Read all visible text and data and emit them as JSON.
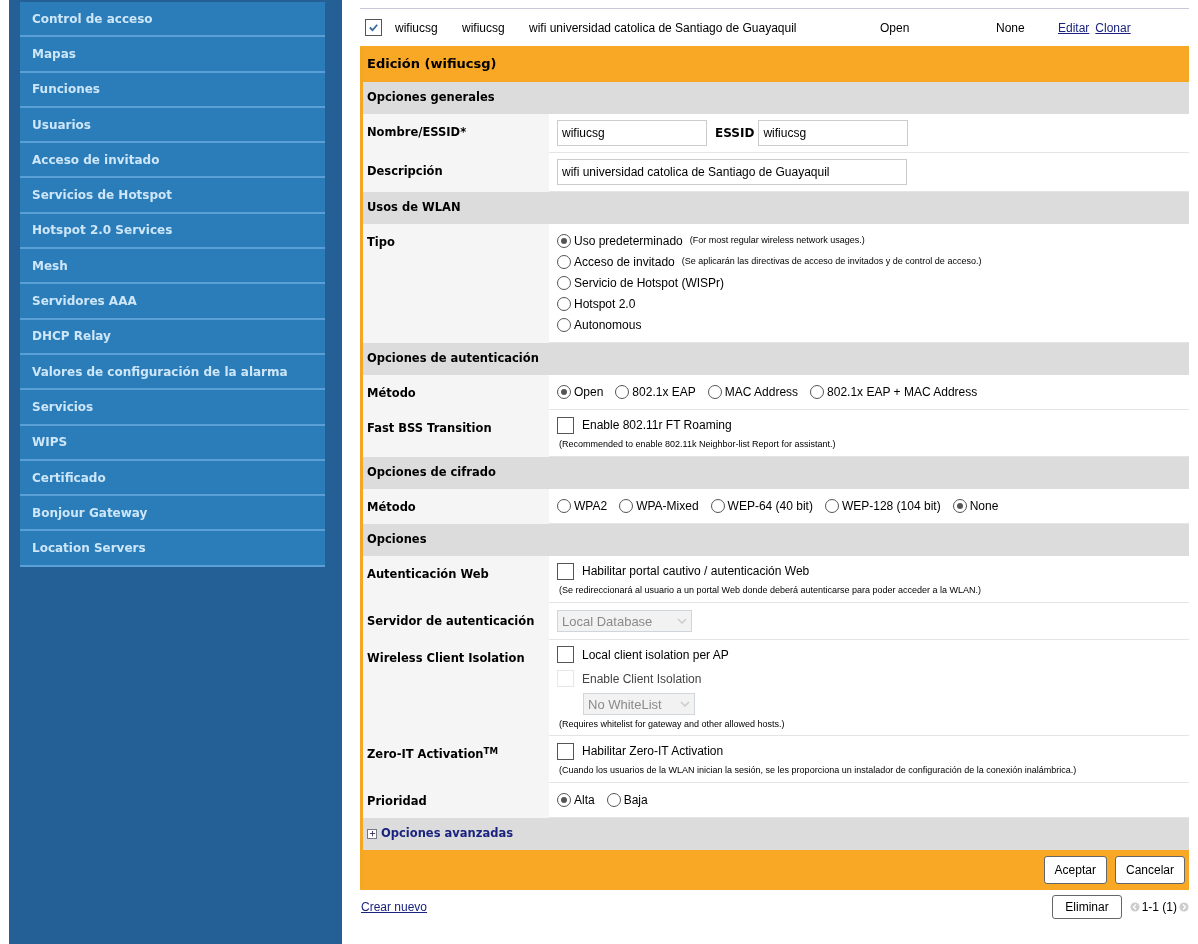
{
  "sidebar": {
    "items": [
      {
        "label": "Control de acceso",
        "selected": false
      },
      {
        "label": "Mapas",
        "selected": false
      },
      {
        "label": "Funciones",
        "selected": false
      },
      {
        "label": "Usuarios",
        "selected": false
      },
      {
        "label": "Acceso de invitado",
        "selected": false
      },
      {
        "label": "Servicios de Hotspot",
        "selected": false
      },
      {
        "label": "Hotspot 2.0 Services",
        "selected": false
      },
      {
        "label": "Mesh",
        "selected": false
      },
      {
        "label": "Servidores AAA",
        "selected": false
      },
      {
        "label": "DHCP Relay",
        "selected": false
      },
      {
        "label": "Valores de configuración de la alarma",
        "selected": false
      },
      {
        "label": "Servicios",
        "selected": false
      },
      {
        "label": "WIPS",
        "selected": false
      },
      {
        "label": "Certificado",
        "selected": false
      },
      {
        "label": "Bonjour Gateway",
        "selected": false
      },
      {
        "label": "Location Servers",
        "selected": false
      }
    ]
  },
  "wlan_row": {
    "checked": true,
    "cells": [
      "wifiucsg",
      "wifiucsg",
      "wifi universidad catolica de Santiago de Guayaquil",
      "Open",
      "None"
    ],
    "links": [
      "Editar",
      "Clonar"
    ]
  },
  "edit_panel": {
    "title": "Edición (wifiucsg)",
    "sections": [
      {
        "title": "Opciones generales",
        "rows": [
          {
            "label": "Nombre/ESSID*",
            "kind": "inline",
            "items": [
              {
                "kind": "text-input",
                "value": "wifiucsg"
              },
              {
                "kind": "inline-label",
                "text": "ESSID"
              },
              {
                "kind": "text-input",
                "value": "wifiucsg"
              }
            ]
          },
          {
            "label": "Descripción",
            "kind": "inline",
            "items": [
              {
                "kind": "text-input",
                "value": "wifi universidad catolica de Santiago de Guayaquil",
                "wide": true
              }
            ]
          }
        ]
      },
      {
        "title": "Usos de WLAN",
        "rows": [
          {
            "label": "Tipo",
            "kind": "stacked",
            "items": [
              {
                "kind": "radio",
                "text": "Uso predeterminado",
                "note": "(For most regular wireless network usages.)",
                "selected": true
              },
              {
                "kind": "radio",
                "text": "Acceso de invitado",
                "note": "(Se aplicarán las directivas de acceso de invitados y de control de acceso.)",
                "selected": false
              },
              {
                "kind": "radio",
                "text": "Servicio de Hotspot (WISPr)",
                "selected": false
              },
              {
                "kind": "radio",
                "text": "Hotspot 2.0",
                "selected": false
              },
              {
                "kind": "radio",
                "text": "Autonomous",
                "selected": false
              }
            ]
          }
        ]
      },
      {
        "title": "Opciones de autenticación",
        "rows": [
          {
            "label": "Método",
            "kind": "inline",
            "items": [
              {
                "kind": "radio",
                "text": "Open",
                "selected": true
              },
              {
                "kind": "radio",
                "text": "802.1x EAP",
                "selected": false
              },
              {
                "kind": "radio",
                "text": "MAC Address",
                "selected": false
              },
              {
                "kind": "radio",
                "text": "802.1x EAP + MAC Address",
                "selected": false
              }
            ]
          },
          {
            "label": "Fast BSS Transition",
            "kind": "stacked",
            "items": [
              {
                "kind": "checkbox",
                "text": "Enable 802.11r FT Roaming",
                "checked": false,
                "disabled": false
              },
              {
                "kind": "note",
                "text": "(Recommended to enable 802.11k Neighbor-list Report for assistant.)"
              }
            ]
          }
        ]
      },
      {
        "title": "Opciones de cifrado",
        "rows": [
          {
            "label": "Método",
            "kind": "inline",
            "items": [
              {
                "kind": "radio",
                "text": "WPA2",
                "selected": false
              },
              {
                "kind": "radio",
                "text": "WPA-Mixed",
                "selected": false
              },
              {
                "kind": "radio",
                "text": "WEP-64 (40 bit)",
                "selected": false
              },
              {
                "kind": "radio",
                "text": "WEP-128 (104 bit)",
                "selected": false
              },
              {
                "kind": "radio",
                "text": "None",
                "selected": true
              }
            ]
          }
        ]
      },
      {
        "title": "Opciones",
        "rows": [
          {
            "label": "Autenticación Web",
            "kind": "stacked",
            "items": [
              {
                "kind": "checkbox",
                "text": "Habilitar portal cautivo / autenticación Web",
                "checked": false,
                "disabled": false
              },
              {
                "kind": "note",
                "text": "(Se redireccionará al usuario a un portal Web donde deberá autenticarse para poder acceder a la WLAN.)"
              }
            ]
          },
          {
            "label": "Servidor de autenticación",
            "kind": "inline",
            "items": [
              {
                "kind": "select",
                "value": "Local Database",
                "disabled": true
              }
            ]
          },
          {
            "label": "Wireless Client Isolation",
            "kind": "stacked",
            "items": [
              {
                "kind": "checkbox",
                "text": "Local client isolation per AP",
                "checked": false,
                "disabled": false
              },
              {
                "kind": "checkbox",
                "text": "Enable Client Isolation",
                "checked": false,
                "disabled": true
              },
              {
                "kind": "select",
                "value": "No WhiteList",
                "disabled": true
              },
              {
                "kind": "note",
                "text": "(Requires whitelist for gateway and other allowed hosts.)"
              }
            ]
          },
          {
            "label": "Zero-IT Activation$^{TM}$",
            "kind": "stacked",
            "items": [
              {
                "kind": "checkbox",
                "text": "Habilitar Zero-IT Activation",
                "checked": false,
                "disabled": false
              },
              {
                "kind": "note",
                "text": "(Cuando los usuarios de la WLAN inician la sesión, se les proporciona un instalador de configuración de la conexión inalámbrica.)"
              }
            ]
          },
          {
            "label": "Prioridad",
            "kind": "inline",
            "items": [
              {
                "kind": "radio",
                "text": "Alta",
                "selected": true
              },
              {
                "kind": "radio",
                "text": "Baja",
                "selected": false
              }
            ]
          }
        ]
      }
    ],
    "advanced": {
      "label": "Opciones avanzadas",
      "expanded": false
    },
    "buttons": [
      "Aceptar",
      "Cancelar"
    ]
  },
  "footer": {
    "create_link": "Crear nuevo",
    "delete_button": "Eliminar",
    "pagination": "1-1 (1)"
  }
}
